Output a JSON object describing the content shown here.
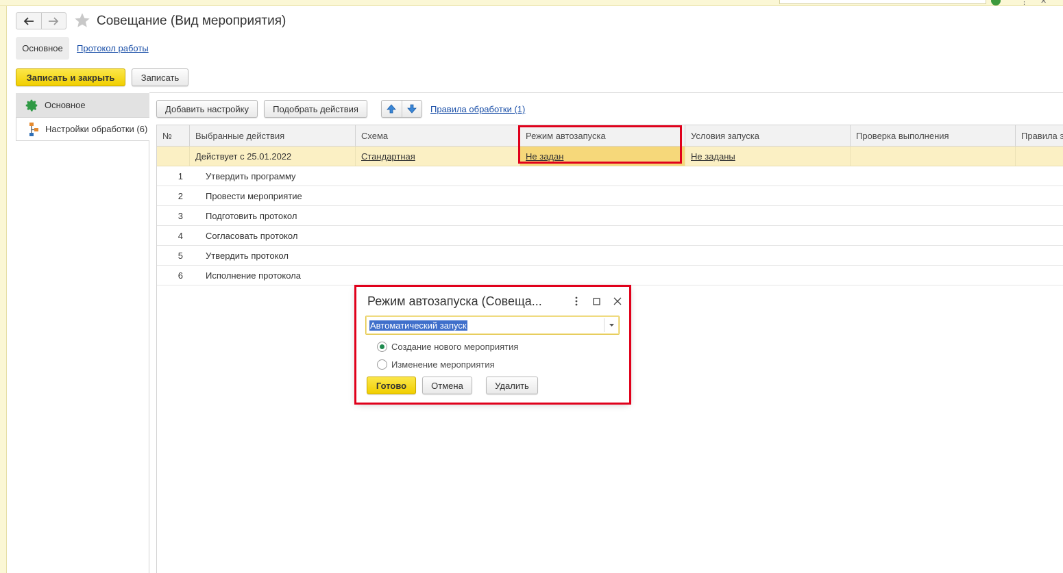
{
  "window": {
    "title": "Совещание (Вид мероприятия)"
  },
  "tabs": {
    "main": "Основное",
    "protocol": "Протокол работы"
  },
  "toolbar": {
    "save_close": "Записать и закрыть",
    "save": "Записать"
  },
  "sidebar": {
    "items": [
      {
        "label": "Основное",
        "icon": "gear-icon"
      },
      {
        "label": "Настройки обработки (6)",
        "icon": "process-flow-icon"
      }
    ]
  },
  "content_toolbar": {
    "add_setting": "Добавить настройку",
    "pick_actions": "Подобрать действия",
    "rules_link": "Правила обработки (1)"
  },
  "table": {
    "columns": [
      "№",
      "Выбранные действия",
      "Схема",
      "Режим автозапуска",
      "Условия запуска",
      "Проверка выполнения",
      "Правила э"
    ],
    "group_row": {
      "action": "Действует с 25.01.2022",
      "scheme": "Стандартная",
      "autostart": "Не задан",
      "conditions": "Не заданы"
    },
    "rows": [
      {
        "num": "1",
        "action": "Утвердить программу"
      },
      {
        "num": "2",
        "action": "Провести мероприятие"
      },
      {
        "num": "3",
        "action": "Подготовить протокол"
      },
      {
        "num": "4",
        "action": "Согласовать протокол"
      },
      {
        "num": "5",
        "action": "Утвердить протокол"
      },
      {
        "num": "6",
        "action": "Исполнение протокола"
      }
    ]
  },
  "dialog": {
    "title": "Режим автозапуска (Совеща...",
    "select_value": "Автоматический запуск",
    "radios": [
      {
        "label": "Создание нового мероприятия",
        "checked": true
      },
      {
        "label": "Изменение мероприятия",
        "checked": false
      }
    ],
    "ok": "Готово",
    "cancel": "Отмена",
    "delete": "Удалить"
  },
  "colors": {
    "accent_yellow": "#f1cf00",
    "highlight_red": "#e0001b",
    "link_blue": "#1a4fa8",
    "selection_blue": "#3f6fcb"
  }
}
